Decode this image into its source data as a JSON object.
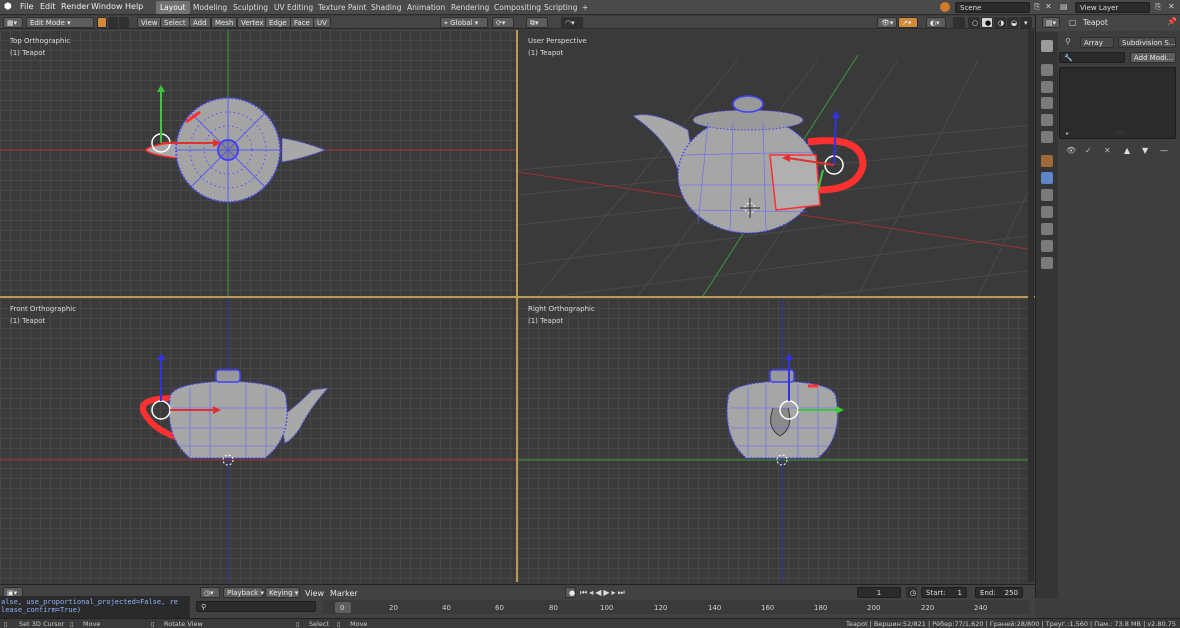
{
  "menu": [
    "File",
    "Edit",
    "Render",
    "Window",
    "Help"
  ],
  "workspaces": [
    "Layout",
    "Modeling",
    "Sculpting",
    "UV Editing",
    "Texture Paint",
    "Shading",
    "Animation",
    "Rendering",
    "Compositing",
    "Scripting",
    "+"
  ],
  "active_workspace": "Layout",
  "scene": "Scene",
  "view_layer": "View Layer",
  "viewport_header": {
    "mode": "Edit Mode",
    "menus": [
      "View",
      "Select",
      "Add",
      "Mesh",
      "Vertex",
      "Edge",
      "Face",
      "UV"
    ],
    "orientation": "Global"
  },
  "viewports": [
    {
      "name": "Top Orthographic",
      "object": "(1) Teapot"
    },
    {
      "name": "User Perspective",
      "object": "(1) Teapot"
    },
    {
      "name": "Front Orthographic",
      "object": "(1) Teapot"
    },
    {
      "name": "Right Orthographic",
      "object": "(1) Teapot"
    }
  ],
  "properties": {
    "object_name": "Teapot",
    "modifier_tabs": [
      "Array",
      "Subdivision S..."
    ],
    "add_modifier": "Add Modi..."
  },
  "timeline": {
    "menus": [
      "Playback",
      "Keying",
      "View",
      "Marker"
    ],
    "current_frame": "1",
    "start_label": "Start:",
    "start": "1",
    "end_label": "End:",
    "end": "250",
    "ticks": [
      "0",
      "20",
      "40",
      "60",
      "80",
      "100",
      "120",
      "140",
      "160",
      "180",
      "200",
      "220",
      "240"
    ]
  },
  "console": {
    "line1": "alse, use_proportional_projected=False, re",
    "line2": "lease_confirm=True)"
  },
  "status": {
    "left": [
      "Set 3D Cursor",
      "Move",
      "Rotate View",
      "Select",
      "Move"
    ],
    "right": "Teapot | Вершин:52/821 | Рёбер:77/1,620 | Граней:28/800 | Треуг.:1,560 | Пам.: 73.8 MB | v2.80.75"
  },
  "colors": {
    "x_axis": "#c83232",
    "y_axis": "#3cc83c",
    "z_axis": "#3232c8",
    "vertex": "#3a3aff",
    "selected": "#ff3030",
    "mesh": "#b4b4b4",
    "accent": "#b89a53"
  }
}
